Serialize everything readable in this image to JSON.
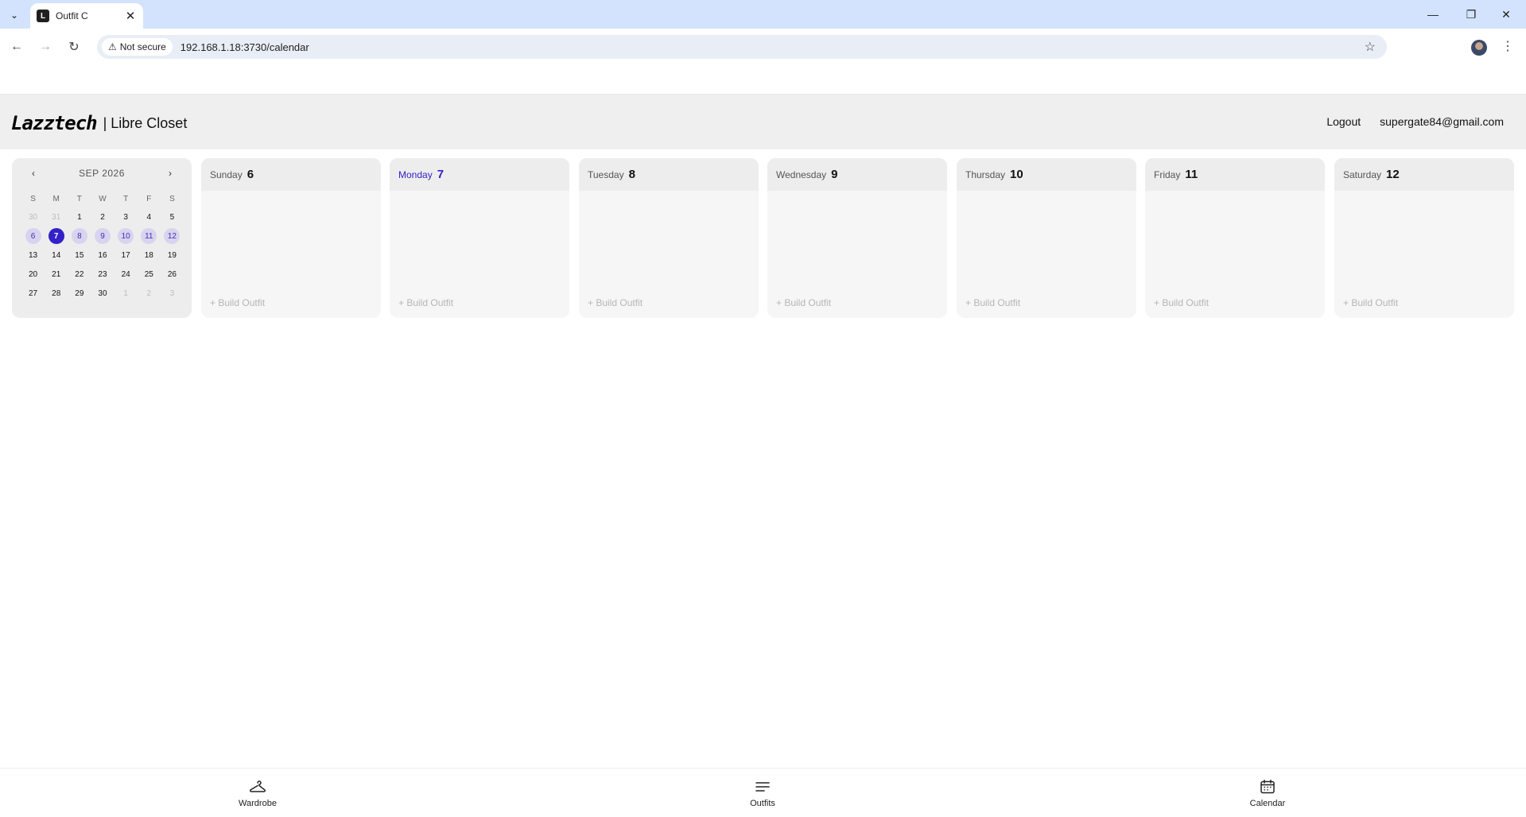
{
  "browser": {
    "tab_title": "Outfit C",
    "favicon_letter": "L",
    "security_label": "Not secure",
    "url": "192.168.1.18:3730/calendar"
  },
  "header": {
    "logo_text": "Lazztech",
    "app_name": "| Libre Closet",
    "logout_label": "Logout",
    "user_email": "supergate84@gmail.com"
  },
  "mini_calendar": {
    "month_label": "SEP 2026",
    "prev_label": "‹",
    "next_label": "›",
    "weekdays": [
      "S",
      "M",
      "T",
      "W",
      "T",
      "F",
      "S"
    ],
    "days": [
      {
        "d": "30",
        "state": "muted"
      },
      {
        "d": "31",
        "state": "muted"
      },
      {
        "d": "1",
        "state": ""
      },
      {
        "d": "2",
        "state": ""
      },
      {
        "d": "3",
        "state": ""
      },
      {
        "d": "4",
        "state": ""
      },
      {
        "d": "5",
        "state": ""
      },
      {
        "d": "6",
        "state": "week"
      },
      {
        "d": "7",
        "state": "today"
      },
      {
        "d": "8",
        "state": "week"
      },
      {
        "d": "9",
        "state": "week"
      },
      {
        "d": "10",
        "state": "week"
      },
      {
        "d": "11",
        "state": "week"
      },
      {
        "d": "12",
        "state": "week"
      },
      {
        "d": "13",
        "state": ""
      },
      {
        "d": "14",
        "state": ""
      },
      {
        "d": "15",
        "state": ""
      },
      {
        "d": "16",
        "state": ""
      },
      {
        "d": "17",
        "state": ""
      },
      {
        "d": "18",
        "state": ""
      },
      {
        "d": "19",
        "state": ""
      },
      {
        "d": "20",
        "state": ""
      },
      {
        "d": "21",
        "state": ""
      },
      {
        "d": "22",
        "state": ""
      },
      {
        "d": "23",
        "state": ""
      },
      {
        "d": "24",
        "state": ""
      },
      {
        "d": "25",
        "state": ""
      },
      {
        "d": "26",
        "state": ""
      },
      {
        "d": "27",
        "state": ""
      },
      {
        "d": "28",
        "state": ""
      },
      {
        "d": "29",
        "state": ""
      },
      {
        "d": "30",
        "state": ""
      },
      {
        "d": "1",
        "state": "muted"
      },
      {
        "d": "2",
        "state": "muted"
      },
      {
        "d": "3",
        "state": "muted"
      }
    ]
  },
  "week": [
    {
      "name": "Sunday",
      "num": "6",
      "build_label": "+ Build Outfit"
    },
    {
      "name": "Monday",
      "num": "7",
      "build_label": "+ Build Outfit",
      "current": true
    },
    {
      "name": "Tuesday",
      "num": "8",
      "build_label": "+ Build Outfit"
    },
    {
      "name": "Wednesday",
      "num": "9",
      "build_label": "+ Build Outfit"
    },
    {
      "name": "Thursday",
      "num": "10",
      "build_label": "+ Build Outfit"
    },
    {
      "name": "Friday",
      "num": "11",
      "build_label": "+ Build Outfit"
    },
    {
      "name": "Saturday",
      "num": "12",
      "build_label": "+ Build Outfit"
    }
  ],
  "bottom_nav": [
    {
      "label": "Wardrobe",
      "icon": "hanger-icon"
    },
    {
      "label": "Outfits",
      "icon": "list-icon"
    },
    {
      "label": "Calendar",
      "icon": "calendar-icon",
      "active": true
    }
  ],
  "colors": {
    "accent": "#3320c8",
    "week_highlight": "#d8d4ef",
    "chrome": "#d3e3fd"
  }
}
